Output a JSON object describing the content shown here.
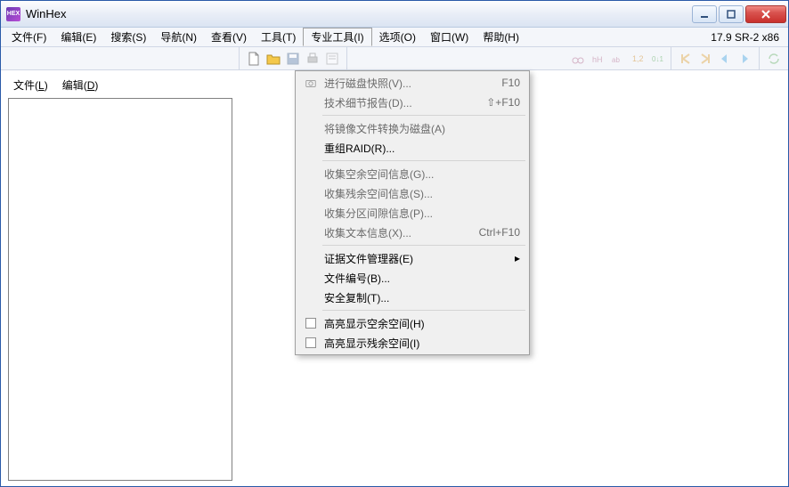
{
  "window": {
    "title": "WinHex",
    "version": "17.9 SR-2 x86"
  },
  "menubar": {
    "items": [
      {
        "label": "文件(F)"
      },
      {
        "label": "编辑(E)"
      },
      {
        "label": "搜索(S)"
      },
      {
        "label": "导航(N)"
      },
      {
        "label": "查看(V)"
      },
      {
        "label": "工具(T)"
      },
      {
        "label": "专业工具(I)"
      },
      {
        "label": "选项(O)"
      },
      {
        "label": "窗口(W)"
      },
      {
        "label": "帮助(H)"
      }
    ],
    "active_index": 6
  },
  "left_tabs": {
    "file": "文件(L)",
    "edit": "编辑(D)"
  },
  "dropdown": {
    "sections": [
      [
        {
          "label": "进行磁盘快照(V)...",
          "shortcut": "F10",
          "enabled": false,
          "icon": "camera"
        },
        {
          "label": "技术细节报告(D)...",
          "shortcut": "⇧+F10",
          "enabled": false
        }
      ],
      [
        {
          "label": "将镜像文件转换为磁盘(A)",
          "enabled": false
        },
        {
          "label": "重组RAID(R)...",
          "enabled": true
        }
      ],
      [
        {
          "label": "收集空余空间信息(G)...",
          "enabled": false
        },
        {
          "label": "收集残余空间信息(S)...",
          "enabled": false
        },
        {
          "label": "收集分区间隙信息(P)...",
          "enabled": false
        },
        {
          "label": "收集文本信息(X)...",
          "shortcut": "Ctrl+F10",
          "enabled": false
        }
      ],
      [
        {
          "label": "证据文件管理器(E)",
          "enabled": true,
          "submenu": true
        },
        {
          "label": "文件编号(B)...",
          "enabled": true
        },
        {
          "label": "安全复制(T)...",
          "enabled": true
        }
      ],
      [
        {
          "label": "高亮显示空余空间(H)",
          "enabled": true,
          "checkbox": true
        },
        {
          "label": "高亮显示残余空间(I)",
          "enabled": true,
          "checkbox": true
        }
      ]
    ]
  }
}
